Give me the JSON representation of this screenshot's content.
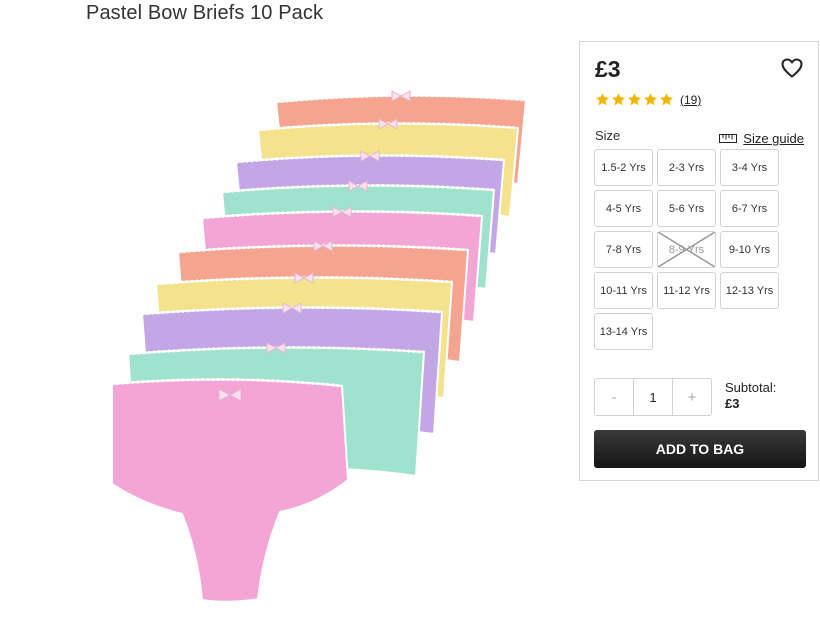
{
  "product": {
    "title": "Pastel Bow Briefs 10 Pack",
    "image_alt": "Pastel bow briefs 10 pack"
  },
  "panel": {
    "price": "£3",
    "rating": {
      "stars": 5,
      "reviews_label": "(19)"
    },
    "size_label": "Size",
    "size_guide_label": "Size guide",
    "sizes": [
      {
        "label": "1.5-2 Yrs",
        "available": true
      },
      {
        "label": "2-3 Yrs",
        "available": true
      },
      {
        "label": "3-4 Yrs",
        "available": true
      },
      {
        "label": "4-5 Yrs",
        "available": true
      },
      {
        "label": "5-6 Yrs",
        "available": true
      },
      {
        "label": "6-7 Yrs",
        "available": true
      },
      {
        "label": "7-8 Yrs",
        "available": true
      },
      {
        "label": "8-9 Yrs",
        "available": false
      },
      {
        "label": "9-10 Yrs",
        "available": true
      },
      {
        "label": "10-11 Yrs",
        "available": true
      },
      {
        "label": "11-12 Yrs",
        "available": true
      },
      {
        "label": "12-13 Yrs",
        "available": true
      },
      {
        "label": "13-14 Yrs",
        "available": true
      }
    ],
    "quantity": {
      "minus": "-",
      "value": "1",
      "plus": "+"
    },
    "subtotal_label": "Subtotal:",
    "subtotal_value": "£3",
    "add_to_bag_label": "ADD TO BAG"
  },
  "colors": {
    "star": "#f2b705",
    "button_dark": "#1f1f1f",
    "pink": "#f3a6d6",
    "mint": "#9fe3cf",
    "lilac": "#c3a6e6",
    "yellow": "#f5e28c",
    "peach": "#f5a48f"
  },
  "icons": [
    "heart-icon",
    "star-icon",
    "ruler-icon"
  ]
}
